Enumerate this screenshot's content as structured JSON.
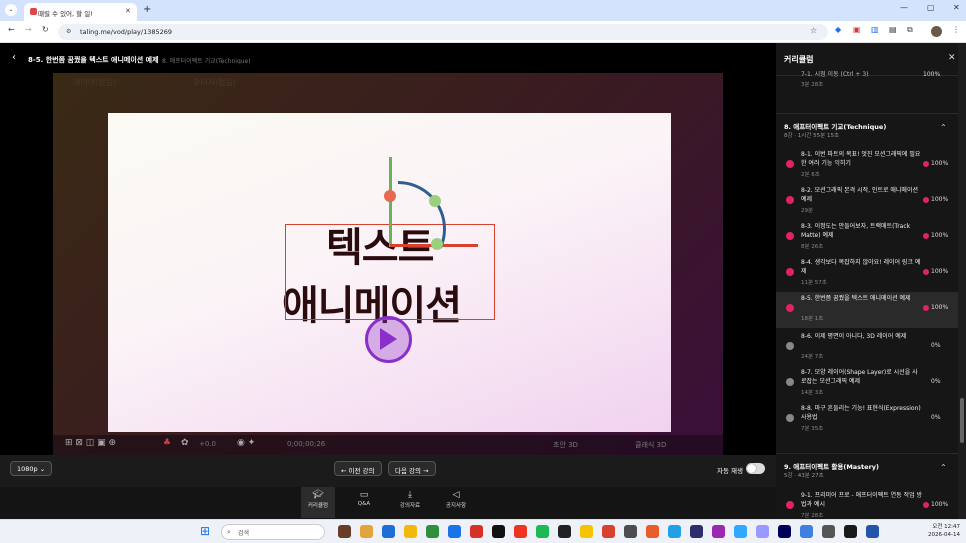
{
  "browser": {
    "tab_title": "때릴 수 있어, 할 일!",
    "url": "taling.me/vod/play/1385269"
  },
  "header": {
    "title": "8-5. 한번쯤 꿈꿨을 텍스트 애니메이션 예제",
    "breadcrumb": "8. 애프터이펙트 기교(Technique)"
  },
  "video": {
    "top_labels": [
      "레이어(없음)",
      "부터지(없음)"
    ],
    "canvas_text_line1": "텍스트",
    "canvas_text_line2": "애니메이션",
    "timecode": "0;00;00;26",
    "exposure": "+0.0",
    "renderer": "초안 3D",
    "view_mode": "클래식 3D"
  },
  "player": {
    "quality": "1080p",
    "prev_label": "← 이전 강의",
    "next_label": "다음 강의 →",
    "autoplay_label": "자동 재생",
    "autoplay_on": false
  },
  "bottom_tabs": [
    {
      "label": "커리큘럼",
      "icon": "graduation-cap-icon"
    },
    {
      "label": "Q&A",
      "icon": "chat-icon"
    },
    {
      "label": "강의자료",
      "icon": "download-icon"
    },
    {
      "label": "공지사항",
      "icon": "megaphone-icon"
    }
  ],
  "sidebar": {
    "title": "커리큘럼",
    "prev_item": {
      "title": "7-1. 시점 이동 (Ctrl + 3)",
      "duration": "3분 28초",
      "progress": "100%"
    },
    "section8": {
      "title": "8. 애프터이펙트 기교(Technique)",
      "meta": "8강 · 1시간 55분 15초"
    },
    "lessons": [
      {
        "title": "8-1. 이번 파트의 목표! 멋진 모션그래픽에 필요한 여러 기능 익히기",
        "duration": "2분 6초",
        "progress": "100%",
        "done": true
      },
      {
        "title": "8-2. 모션그래픽 본격 시작, 인트로 애니메이션 예제",
        "duration": "29분",
        "progress": "100%",
        "done": true
      },
      {
        "title": "8-3. 이정도는 만들어보자, 트랙매트(Track Matte) 예제",
        "duration": "8분 26초",
        "progress": "100%",
        "done": true
      },
      {
        "title": "8-4. 생각보다 복잡하지 않아요! 레이어 링크 예제",
        "duration": "11분 57초",
        "progress": "100%",
        "done": true
      },
      {
        "title": "8-5. 한번쯤 꿈꿨을 텍스트 애니메이션 예제",
        "duration": "18분 1초",
        "progress": "100%",
        "done": true
      },
      {
        "title": "8-6. 이제 평면이 아니다, 3D 레이어 예제",
        "duration": "24분 7초",
        "progress": "0%",
        "done": false
      },
      {
        "title": "8-7. 모양 레이어(Shape Layer)로 시선을 사로잡는 모션그래픽 예제",
        "duration": "14분 3초",
        "progress": "0%",
        "done": false
      },
      {
        "title": "8-8. 마구 흔들리는 기능! 표현식(Expression) 사용법",
        "duration": "7분 35초",
        "progress": "0%",
        "done": false
      }
    ],
    "section9": {
      "title": "9. 애프터이펙트 활용(Mastery)",
      "meta": "5강 · 43분 27초"
    },
    "section9_first": {
      "title": "9-1. 프리미어 프로 - 애프터이펙트 연동 작업 방법과 예시",
      "duration": "7분 28초",
      "progress": "100%"
    }
  },
  "taskbar": {
    "search_placeholder": "검색",
    "time": "오전 12:47",
    "date": "2026-04-14"
  },
  "colors": {
    "accent": "#e0245e",
    "play_purple": "#8b2fc9"
  }
}
